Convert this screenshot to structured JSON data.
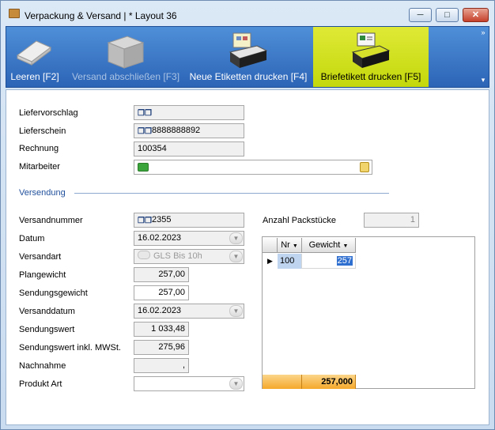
{
  "window": {
    "title": "Verpackung & Versand | * Layout 36",
    "minimize": "─",
    "maximize": "□",
    "close": "✕"
  },
  "ribbon": {
    "items": [
      {
        "label": "Leeren [F2]",
        "icon": "eraser-icon"
      },
      {
        "label": "Versand abschließen [F3]",
        "icon": "package-icon",
        "disabled": true
      },
      {
        "label": "Neue Etiketten drucken [F4]",
        "icon": "label-printer-icon"
      },
      {
        "label": "Briefetikett drucken [F5]",
        "icon": "letter-printer-icon",
        "active": true
      }
    ],
    "collapse_glyph": "»",
    "options_glyph": "▾"
  },
  "form": {
    "liefervorschlag": {
      "label": "Liefervorschlag",
      "value": ""
    },
    "lieferschein": {
      "label": "Lieferschein",
      "value": "8888888892"
    },
    "rechnung": {
      "label": "Rechnung",
      "value": "100354"
    },
    "mitarbeiter": {
      "label": "Mitarbeiter",
      "value": ""
    }
  },
  "section": {
    "title": "Versendung"
  },
  "versand": {
    "versandnummer": {
      "label": "Versandnummer",
      "value": "2355"
    },
    "datum": {
      "label": "Datum",
      "value": "16.02.2023"
    },
    "versandart": {
      "label": "Versandart",
      "value": "GLS Bis 10h"
    },
    "plangewicht": {
      "label": "Plangewicht",
      "value": "257,00"
    },
    "sendungsgewicht": {
      "label": "Sendungsgewicht",
      "value": "257,00"
    },
    "versanddatum": {
      "label": "Versanddatum",
      "value": "16.02.2023"
    },
    "sendungswert": {
      "label": "Sendungswert",
      "value": "1 033,48"
    },
    "sendungswert_mwst": {
      "label": "Sendungswert inkl. MWSt.",
      "value": "275,96"
    },
    "nachnahme": {
      "label": "Nachnahme",
      "value": ","
    },
    "produkt_art": {
      "label": "Produkt Art",
      "value": ""
    }
  },
  "packstuecke": {
    "label": "Anzahl Packstücke",
    "value": "1",
    "columns": [
      "Nr",
      "Gewicht"
    ],
    "rows": [
      {
        "nr": "100",
        "gewicht": "257"
      }
    ],
    "total": "257,000"
  },
  "colors": {
    "ribbon": "#2c64b6",
    "ribbon_active": "#c3d80b",
    "section": "#1f4f9c",
    "footer": "#f5a82b"
  }
}
